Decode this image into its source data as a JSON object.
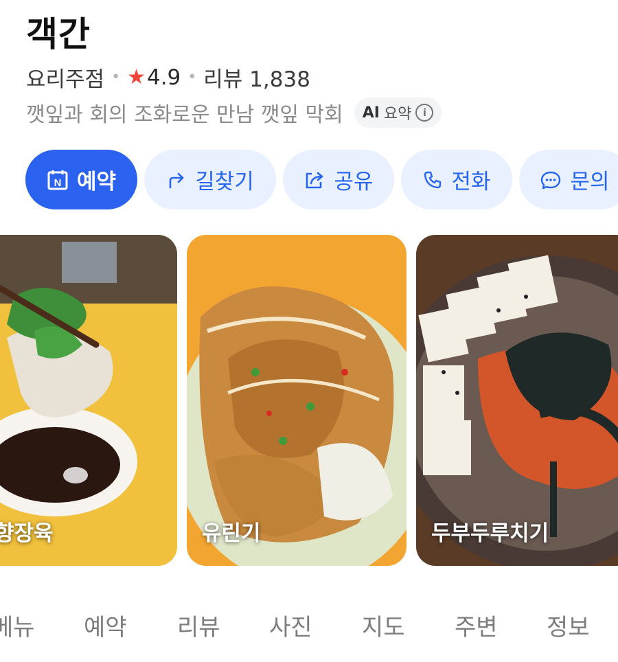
{
  "place": {
    "name": "객간",
    "category": "요리주점",
    "rating": "4.9",
    "review_label": "리뷰 1,838",
    "summary": "깻잎과 회의 조화로운 만남 깻잎 막회",
    "ai_label": "AI",
    "ai_summary_label": "요약",
    "info_glyph": "i"
  },
  "actions": {
    "reserve_icon_text": "N",
    "reserve": "예약",
    "directions": "길찾기",
    "share": "공유",
    "call": "전화",
    "inquiry": "문의"
  },
  "menu_cards": [
    {
      "label": "향장육"
    },
    {
      "label": "유린기"
    },
    {
      "label": "두부두루치기"
    }
  ],
  "tabs": [
    "메뉴",
    "예약",
    "리뷰",
    "사진",
    "지도",
    "주변",
    "정보"
  ],
  "colors": {
    "primary": "#2b63f0",
    "chip_bg": "#e9f0ff",
    "star": "#f0433a"
  }
}
